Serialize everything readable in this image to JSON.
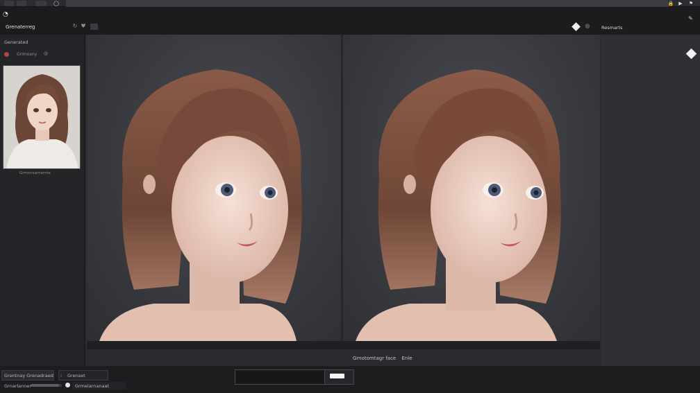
{
  "window": {
    "tab_title": "",
    "title": "Grenaterreg"
  },
  "toolbar": {
    "right_label": "Resmarts"
  },
  "left_panel": {
    "header": "Generated",
    "row_label": "Grimoany",
    "thumbnail_caption": "Grmnnsarnemte"
  },
  "canvas": {
    "caption_a": "Grnotomtagr face",
    "caption_b": "Enle"
  },
  "bottom": {
    "left_top_label": "Grentnay Grenadraed",
    "left_top_tag": "Grenset",
    "left_bottom_label": "Grnarlanner",
    "slider_label": "Grmelarnanaat",
    "slider_value": 0.9,
    "input_value": ""
  },
  "icons": {
    "refresh": "refresh-icon",
    "heart": "heart-icon",
    "diamond": "diamond-icon",
    "moon": "moon-icon",
    "pin": "pin-icon"
  },
  "colors": {
    "background": "#1e1f21",
    "accent_dot": "#b0463d"
  }
}
